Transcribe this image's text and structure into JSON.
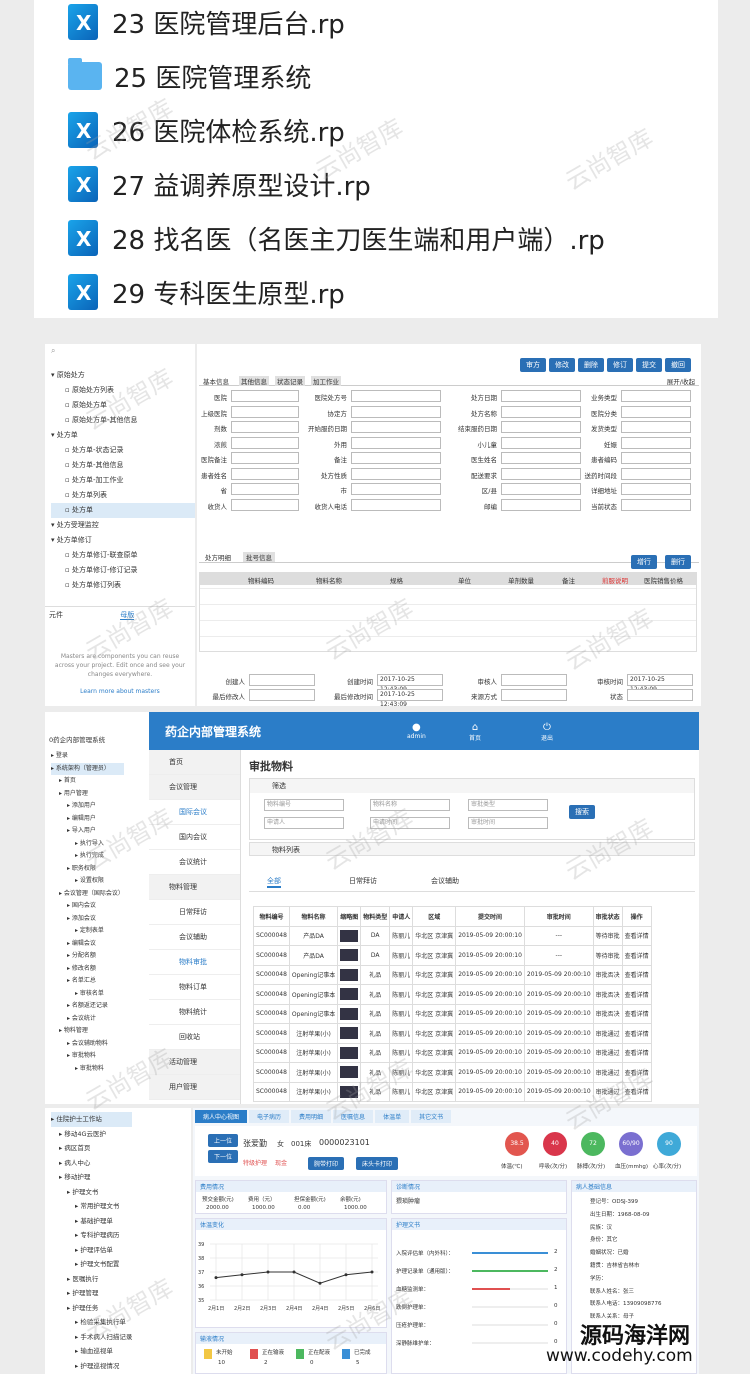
{
  "file_list": [
    {
      "name": "23 医院管理后台.rp",
      "icon": "rp-file-icon"
    },
    {
      "name": "25 医院管理系统",
      "icon": "folder-icon"
    },
    {
      "name": "26 医院体检系统.rp",
      "icon": "rp-file-icon"
    },
    {
      "name": "27 益调养原型设计.rp",
      "icon": "rp-file-icon"
    },
    {
      "name": "28 找名医（名医主刀医生端和用户端）.rp",
      "icon": "rp-file-icon"
    },
    {
      "name": "29 专科医生原型.rp",
      "icon": "rp-file-icon"
    }
  ],
  "watermark": "云尚智库",
  "panel1": {
    "tree": [
      "原始处方",
      "原始处方列表",
      "原始处方单",
      "原始处方单-其他信息",
      "处方单",
      "处方单-状态记录",
      "处方单-其他信息",
      "处方单-加工作业",
      "处方单列表",
      "处方单",
      "处方受理监控",
      "处方单修订",
      "处方单修订-联查原单",
      "处方单修订-修订记录",
      "处方单修订列表"
    ],
    "lib_tabs": [
      "元件",
      "母版"
    ],
    "masters_text": "Masters are components you can reuse across your project. Edit once and see your changes everywhere.",
    "masters_link": "Learn more about masters",
    "toolbar": [
      "审方",
      "修改",
      "删除",
      "修订",
      "提交",
      "撤回"
    ],
    "tabs": [
      "基本信息",
      "其他信息",
      "状态记录",
      "加工作业"
    ],
    "expand": "展开/收起",
    "fields": [
      "医院",
      "医院处方号",
      "处方日期",
      "业务类型",
      "上级医院",
      "协定方",
      "处方名称",
      "医院分类",
      "剂数",
      "开始服药日期",
      "结束服药日期",
      "发货类型",
      "浓煎",
      "外用",
      "小儿童",
      "妊娠",
      "医院备注",
      "备注",
      "医生姓名",
      "患者编码",
      "患者姓名",
      "处方性质",
      "配送要求",
      "送药时间段",
      "省",
      "市",
      "区/县",
      "详细地址",
      "收货人",
      "收货人电话",
      "邮编",
      "当前状态"
    ],
    "detail_tabs": [
      "处方明细",
      "批号信息"
    ],
    "detail_buttons": [
      "增行",
      "删行"
    ],
    "detail_headers": [
      "物料编码",
      "物料名称",
      "规格",
      "单位",
      "单剂数量",
      "备注",
      "煎服说明",
      "医院销售价格"
    ],
    "footer_labels": [
      "创建人",
      "创建时间",
      "审核人",
      "审核时间",
      "最后修改人",
      "最后修改时间",
      "来源方式",
      "状态"
    ],
    "time1": "2017-10-25 12:43:09",
    "time2": "2017-10-25 12:43:09",
    "time3": "2017-10-25 12:43:09"
  },
  "panel2": {
    "project": "0药企内部管理系统",
    "tree": [
      "登录",
      "系统架构（管理员）",
      "首页",
      "用户管理",
      "添加用户",
      "编辑用户",
      "导入用户",
      "执行导入",
      "执行完成",
      "职务权限",
      "设置权限",
      "会议管理（国际会议）",
      "国内会议",
      "添加会议",
      "定制表单",
      "编辑会议",
      "分配名额",
      "修改名额",
      "名单汇总",
      "审核名单",
      "名额返还记录",
      "会议统计",
      "物料管理",
      "会议辅助物料",
      "审批物料",
      "审批物料"
    ],
    "app_title": "药企内部管理系统",
    "header_icons": [
      "admin",
      "首页",
      "退出"
    ],
    "menu": [
      "首页",
      "会议管理",
      "国际会议",
      "国内会议",
      "会议统计",
      "物料管理",
      "日常拜访",
      "会议辅助",
      "物料审批",
      "物料订单",
      "物料统计",
      "回收站",
      "活动管理",
      "用户管理"
    ],
    "page_title": "审批物料",
    "filter_title": "筛选",
    "filters": [
      "物料编号",
      "物料名称",
      "审批类型",
      "申请人",
      "申请时间",
      "审批时间"
    ],
    "search_btn": "搜索",
    "list_title": "物料列表",
    "list_tabs": [
      "全部",
      "日常拜访",
      "会议辅助"
    ],
    "table_headers": [
      "物料编号",
      "物料名称",
      "缩略图",
      "物料类型",
      "申请人",
      "区域",
      "提交时间",
      "审批时间",
      "审批状态",
      "操作"
    ],
    "rows": [
      [
        "SC000048",
        "产品DA",
        "",
        "DA",
        "陈丽儿",
        "华北区  京津冀",
        "2019-05-09 20:00:10",
        "---",
        "等待审批",
        "查看详情"
      ],
      [
        "SC000048",
        "产品DA",
        "",
        "DA",
        "陈丽儿",
        "华北区  京津冀",
        "2019-05-09 20:00:10",
        "---",
        "等待审批",
        "查看详情"
      ],
      [
        "SC000048",
        "Opening记事本",
        "",
        "礼品",
        "陈丽儿",
        "华北区  京津冀",
        "2019-05-09 20:00:10",
        "2019-05-09 20:00:10",
        "审批否决",
        "查看详情"
      ],
      [
        "SC000048",
        "Opening记事本",
        "",
        "礼品",
        "陈丽儿",
        "华北区  京津冀",
        "2019-05-09 20:00:10",
        "2019-05-09 20:00:10",
        "审批否决",
        "查看详情"
      ],
      [
        "SC000048",
        "Opening记事本",
        "",
        "礼品",
        "陈丽儿",
        "华北区  京津冀",
        "2019-05-09 20:00:10",
        "2019-05-09 20:00:10",
        "审批否决",
        "查看详情"
      ],
      [
        "SC000048",
        "注射苹果(小)",
        "",
        "礼品",
        "陈丽儿",
        "华北区  京津冀",
        "2019-05-09 20:00:10",
        "2019-05-09 20:00:10",
        "审批通过",
        "查看详情"
      ],
      [
        "SC000048",
        "注射苹果(小)",
        "",
        "礼品",
        "陈丽儿",
        "华北区  京津冀",
        "2019-05-09 20:00:10",
        "2019-05-09 20:00:10",
        "审批通过",
        "查看详情"
      ],
      [
        "SC000048",
        "注射苹果(小)",
        "",
        "礼品",
        "陈丽儿",
        "华北区  京津冀",
        "2019-05-09 20:00:10",
        "2019-05-09 20:00:10",
        "审批通过",
        "查看详情"
      ],
      [
        "SC000048",
        "注射苹果(小)",
        "",
        "礼品",
        "陈丽儿",
        "华北区  京津冀",
        "2019-05-09 20:00:10",
        "2019-05-09 20:00:10",
        "审批通过",
        "查看详情"
      ]
    ]
  },
  "panel3": {
    "tree": [
      "住院护士工作站",
      "移动4G云医护",
      "病区首页",
      "病人中心",
      "移动护理",
      "护理文书",
      "常用护理文书",
      "基础护理单",
      "专科护理病历",
      "护理评估单",
      "护理文书配置",
      "医嘱执行",
      "护理管理",
      "护理任务",
      "检验采集执行单",
      "手术病人扫描记录",
      "输血巡视单",
      "护理巡视情况"
    ],
    "tabs": [
      "病人中心视图",
      "电子病历",
      "费用明细",
      "医嘱信息",
      "体温单",
      "其它文书"
    ],
    "nav_buttons": [
      "上一位",
      "下一位"
    ],
    "patient": {
      "name": "张爱勤",
      "sex": "女",
      "bed": "001床",
      "id": "0000023101",
      "tags": [
        "特级护理",
        "现金"
      ],
      "btns": [
        "腕带打印",
        "床头卡打印"
      ]
    },
    "vitals": [
      {
        "value": "38.5",
        "label": "体温(℃)",
        "color": "#e2564f"
      },
      {
        "value": "40",
        "label": "呼吸(次/分)",
        "color": "#d9364b"
      },
      {
        "value": "72",
        "label": "脉搏(次/分)",
        "color": "#4cb85f"
      },
      {
        "value": "60/90",
        "label": "血压(mmhg)",
        "color": "#7a6fd0"
      },
      {
        "value": "90",
        "label": "心率(次/分)",
        "color": "#3fa9d8"
      }
    ],
    "cost_title": "费用情况",
    "cost_headers": [
      "预交金额(元)",
      "费用（元）",
      "担保金额(元)",
      "余额(元)"
    ],
    "cost_values": [
      "2000.00",
      "1000.00",
      "0.00",
      "1000.00"
    ],
    "diag_title": "诊断情况",
    "diag_text": "猥琐肿瘤",
    "info_title": "病人基础信息",
    "info": [
      "登记号：ODSJ-399",
      "出生日期：1968-08-09",
      "民族：汉",
      "身份：其它",
      "婚姻状况：已婚",
      "籍贯：吉林省吉林市",
      "学历：",
      "联系人姓名：张三",
      "联系人电话：13909098776",
      "联系人关系：母子"
    ],
    "temp_title": "体温变化",
    "temp_y": [
      "39",
      "38",
      "37",
      "36",
      "35"
    ],
    "temp_x": [
      "2月1日",
      "2月2日",
      "2月3日",
      "2月4日",
      "2月4日",
      "2月5日",
      "2月6日"
    ],
    "nurse_title": "护理文书",
    "nurse_items": [
      "入院评估单（内外科）：",
      "护理记录单（通用版）：",
      "血糖监测单：",
      "跌倒护理单：",
      "压疮护理单：",
      "深静脉维护单："
    ],
    "nurse_counts": [
      "2",
      "2",
      "1",
      "0",
      "0",
      "0"
    ],
    "infusion_title": "输液情况",
    "infusion": [
      {
        "label": "未开始",
        "count": "10"
      },
      {
        "label": "正在输液",
        "count": "2"
      },
      {
        "label": "正在配液",
        "count": "0"
      },
      {
        "label": "已完成",
        "count": "5"
      }
    ]
  },
  "site_brand": "源码海洋网",
  "site_url": "www.codehy.com"
}
